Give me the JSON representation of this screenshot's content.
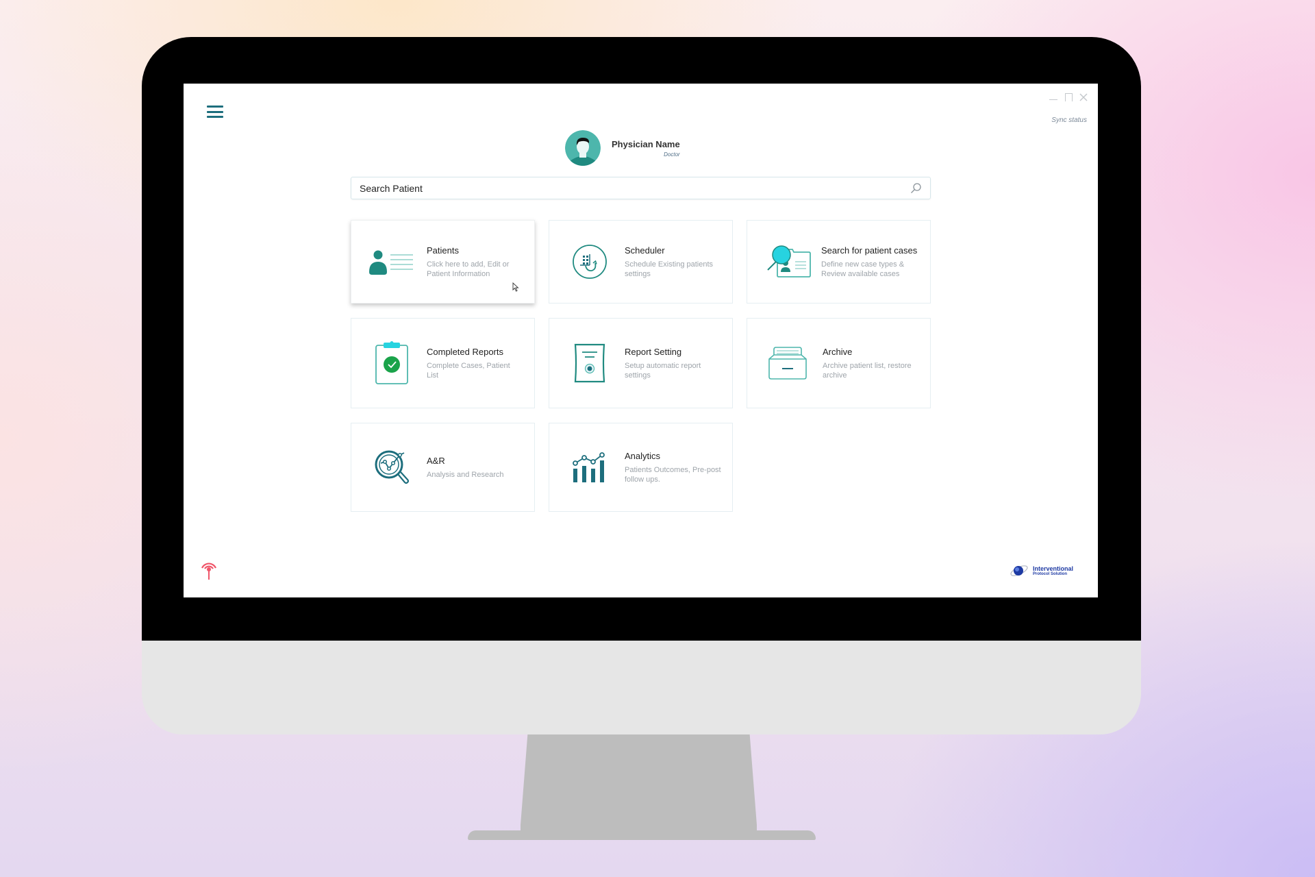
{
  "app": {
    "window_controls": [
      "minimize",
      "maximize",
      "close"
    ],
    "sync_status_label": "Sync status"
  },
  "profile": {
    "name": "Physician Name",
    "role": "Doctor"
  },
  "search": {
    "placeholder": "Search Patient",
    "value": ""
  },
  "cards": [
    {
      "title": "Patients",
      "desc": "Click here to add, Edit or Patient Information",
      "icon": "patient-list-icon"
    },
    {
      "title": "Scheduler",
      "desc": "Schedule Existing patients settings",
      "icon": "scheduler-icon"
    },
    {
      "title": "Search for patient cases",
      "desc": "Define new case types  & Review available cases",
      "icon": "case-search-icon"
    },
    {
      "title": "Completed Reports",
      "desc": "Complete Cases, Patient List",
      "icon": "clipboard-check-icon"
    },
    {
      "title": "Report Setting",
      "desc": "Setup automatic report settings",
      "icon": "report-settings-icon"
    },
    {
      "title": "Archive",
      "desc": "Archive patient list, restore archive",
      "icon": "archive-box-icon"
    },
    {
      "title": "A&R",
      "desc": "Analysis and Research",
      "icon": "analysis-magnifier-icon"
    },
    {
      "title": "Analytics",
      "desc": "Patients Outcomes, Pre-post follow ups.",
      "icon": "analytics-chart-icon"
    }
  ],
  "footer": {
    "logo_line1": "Interventional",
    "logo_line2": "Protocol Solution"
  },
  "colors": {
    "primary_teal": "#1d6e7d",
    "accent_teal": "#1f8a80",
    "light_teal": "#4db6ac",
    "cyan": "#27d3e0",
    "check_green": "#1aa34a",
    "signal_red": "#f0566a",
    "logo_blue": "#1e3aa3"
  }
}
